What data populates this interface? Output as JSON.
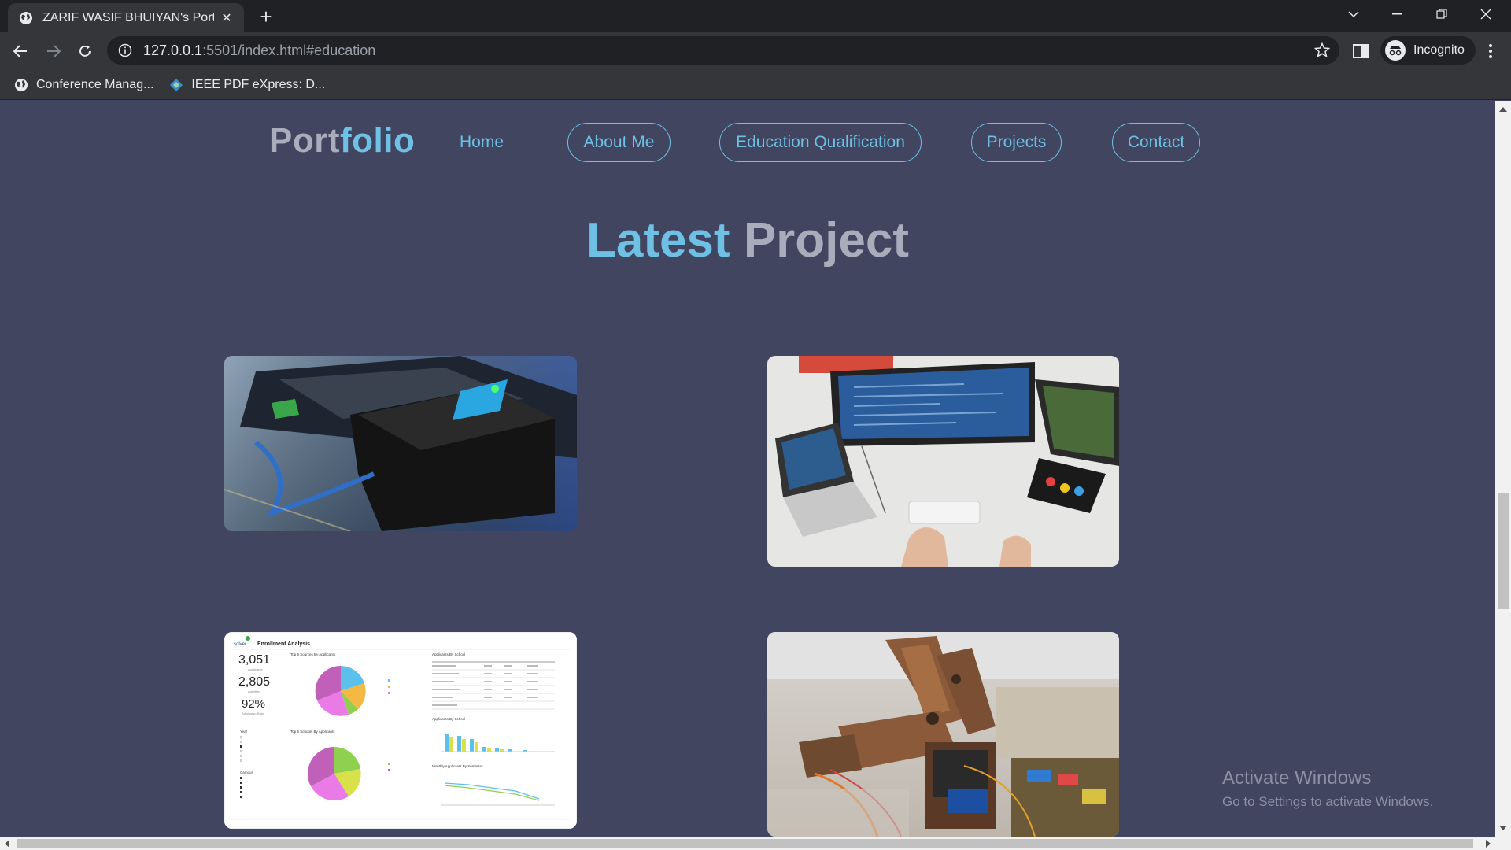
{
  "browser": {
    "tab_title": "ZARIF WASIF BHUIYAN's Portfolio",
    "url_host": "127.0.0.1",
    "url_rest": ":5501/index.html#education",
    "profile_label": "Incognito",
    "bookmarks": [
      {
        "label": "Conference Manag...",
        "icon": "globe-icon"
      },
      {
        "label": "IEEE PDF eXpress: D...",
        "icon": "ieee-diamond-icon"
      }
    ]
  },
  "site": {
    "logo_part1": "Port",
    "logo_part2": "folio",
    "nav": {
      "home": "Home",
      "about": "About Me",
      "education": "Education Qualification",
      "projects": "Projects",
      "contact": "Contact"
    },
    "section_title_part1": "Latest",
    "section_title_part2": "Project",
    "projects": [
      {
        "name": "hardware-box-project",
        "icon": "device-photo"
      },
      {
        "name": "coding-desk-project",
        "icon": "workstation-photo"
      },
      {
        "name": "enrollment-dashboard-project",
        "icon": "dashboard-screenshot"
      },
      {
        "name": "robotic-arm-project",
        "icon": "robot-arm-photo"
      }
    ],
    "dashboard": {
      "title": "Enrollment Analysis",
      "brand": "solver",
      "applicants_value": "3,051",
      "applicants_label": "Applicants",
      "admitted_value": "2,805",
      "admitted_label": "Admitted",
      "rate_value": "92%",
      "rate_label": "Admission Rate",
      "pie1_title": "Top 5 Sources By Applicants",
      "pie2_title": "Top 5 Schools By Applicants",
      "table_title": "Applicants By School",
      "bar_title": "Applicants By School",
      "line_title": "Monthly Applicants By Semester",
      "year_label": "Year",
      "campus_label": "Campus"
    }
  },
  "os_watermark": {
    "line1": "Activate Windows",
    "line2": "Go to Settings to activate Windows."
  },
  "colors": {
    "page_bg": "#41455f",
    "accent": "#6ec1e4",
    "muted_text": "#a9acba"
  }
}
